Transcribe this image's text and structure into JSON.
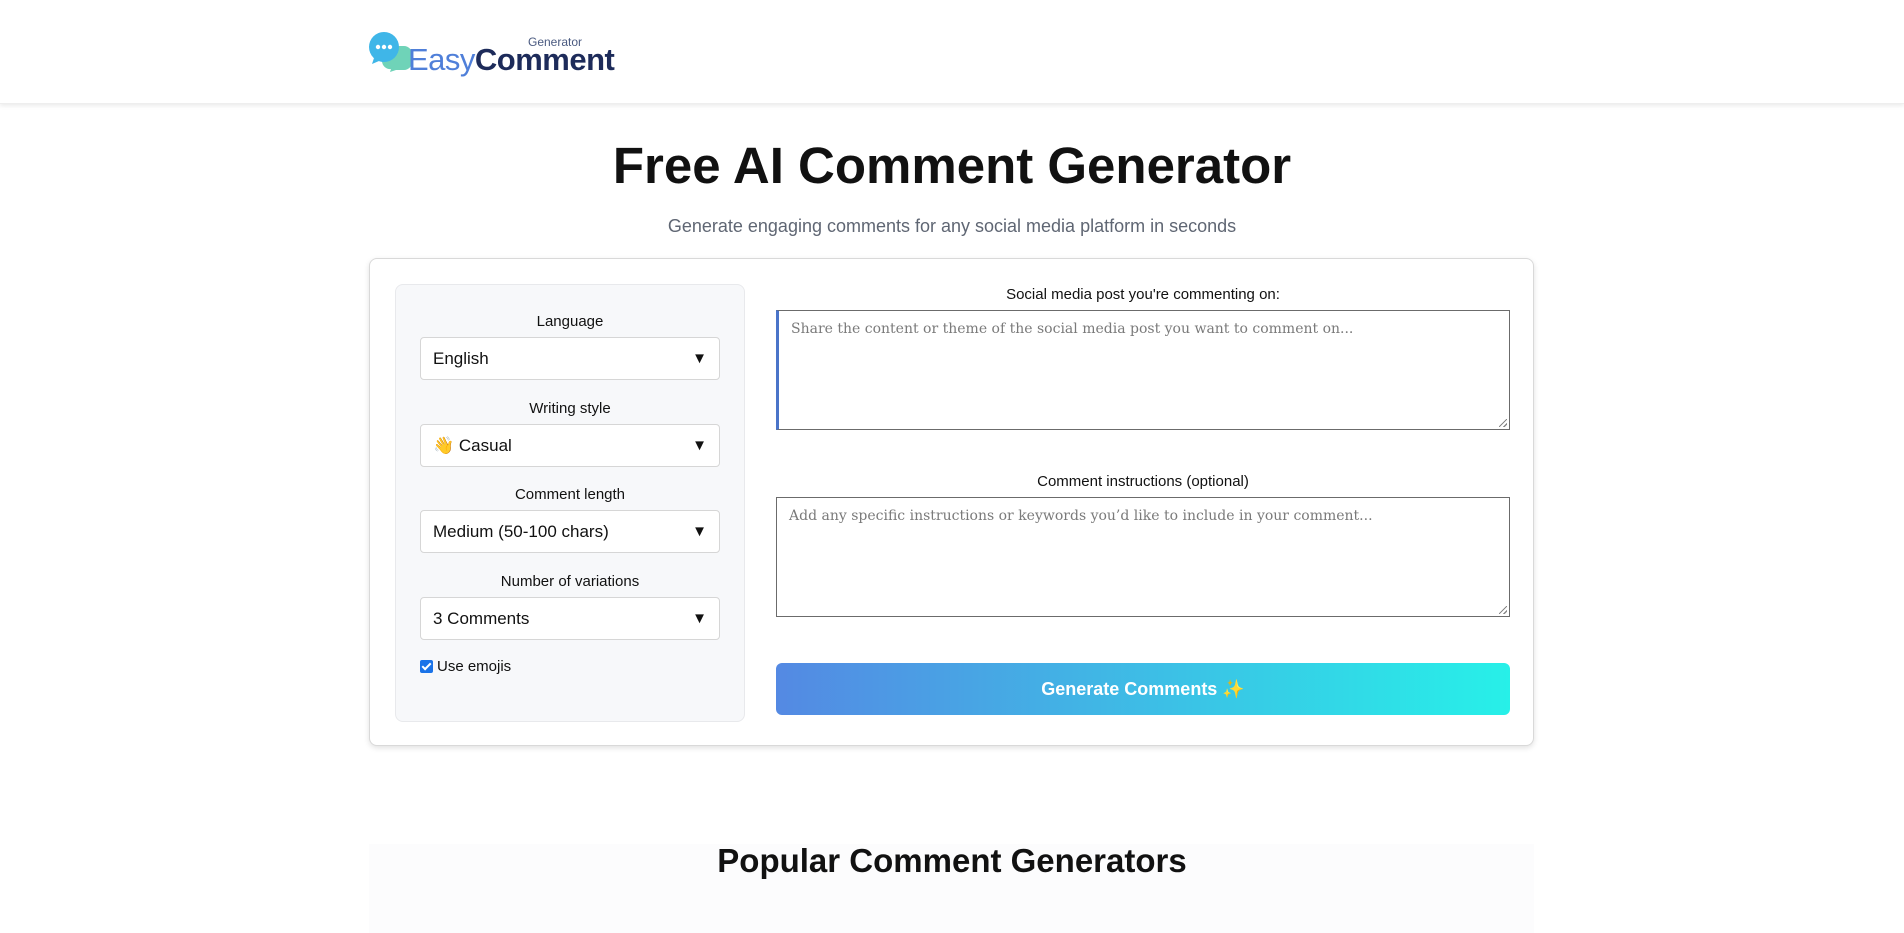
{
  "brand": {
    "logo_easy": "Easy",
    "logo_comment": "Comment",
    "logo_sub": "Generator",
    "colors": {
      "primary": "#4f7fd9",
      "dark": "#1d2b5a",
      "gradient_start": "#5489e3",
      "gradient_end": "#27f0e8"
    }
  },
  "hero": {
    "title": "Free AI Comment Generator",
    "subtitle": "Generate engaging comments for any social media platform in seconds"
  },
  "settings": {
    "language": {
      "label": "Language",
      "value": "English"
    },
    "writing_style": {
      "label": "Writing style",
      "value": "👋 Casual"
    },
    "comment_length": {
      "label": "Comment length",
      "value": "Medium (50-100 chars)"
    },
    "variations": {
      "label": "Number of variations",
      "value": "3 Comments"
    },
    "use_emojis": {
      "label": "Use emojis",
      "checked": true
    },
    "caret_icon": "▼"
  },
  "inputs": {
    "post": {
      "label": "Social media post you're commenting on:",
      "placeholder": "Share the content or theme of the social media post you want to comment on..."
    },
    "instructions": {
      "label": "Comment instructions (optional)",
      "placeholder": "Add any specific instructions or keywords you’d like to include in your comment..."
    }
  },
  "generate_button": {
    "label": "Generate Comments ✨"
  },
  "popular": {
    "title": "Popular Comment Generators"
  }
}
